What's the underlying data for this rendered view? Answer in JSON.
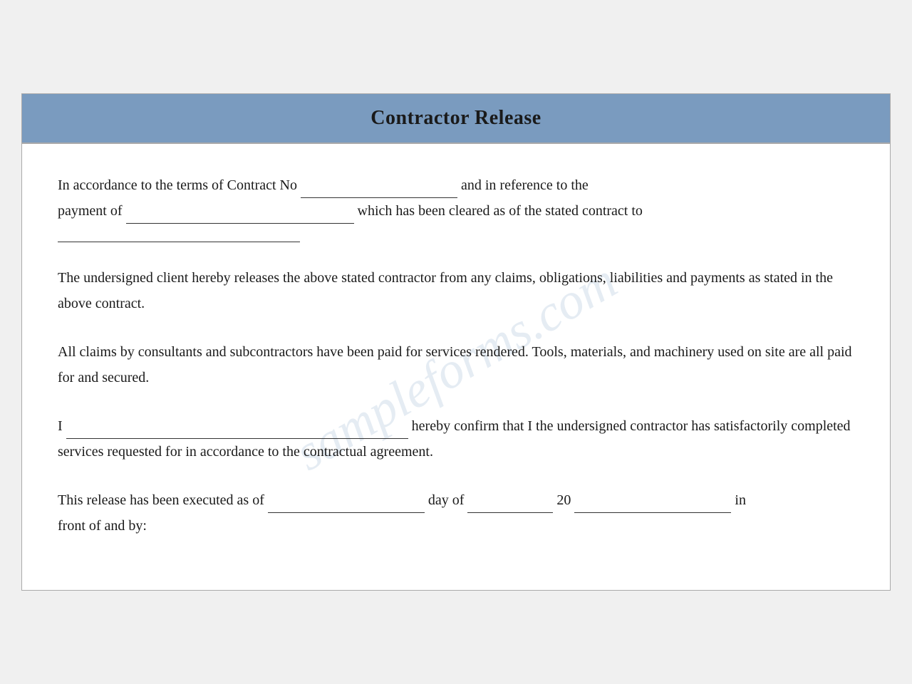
{
  "document": {
    "title": "Contractor Release",
    "header_bg": "#7a9bbf",
    "watermark": "sampleforms.com",
    "paragraphs": {
      "p1_part1": "In accordance to the terms of Contract No",
      "p1_part2": "and in reference to  the",
      "p1_part3": "payment of",
      "p1_part4": "which has been cleared as of the stated contract to",
      "p2": "The undersigned client hereby releases the above stated contractor from any claims, obligations, liabilities and payments as stated in the above contract.",
      "p3": "All claims by consultants and subcontractors have been paid for services rendered. Tools, materials, and machinery used on site are all paid for and secured.",
      "p4_part1": "I",
      "p4_part2": "hereby confirm that I the undersigned contractor has satisfactorily completed services requested for in accordance to the contractual agreement.",
      "p5_part1": "This release has been executed as of",
      "p5_part2": "day of",
      "p5_part3": "20",
      "p5_part4": "in",
      "p5_part5": "front of and by:"
    }
  }
}
